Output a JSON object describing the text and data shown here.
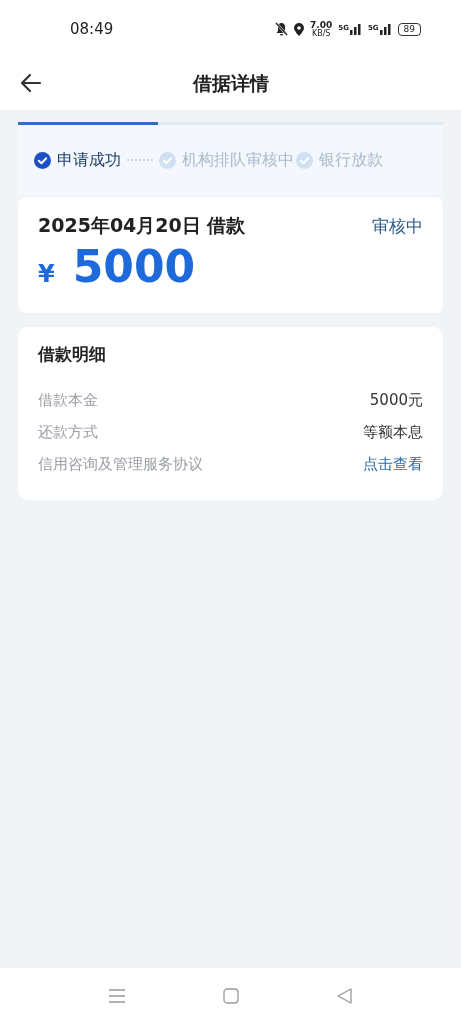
{
  "status_bar": {
    "time": "08:49",
    "speed": "7.00",
    "speed_unit": "KB/S",
    "networks": [
      "5G",
      "5G"
    ],
    "battery": "89"
  },
  "header": {
    "title": "借据详情"
  },
  "progress": {
    "level": 0.33,
    "steps": [
      {
        "label": "申请成功",
        "done": true
      },
      {
        "label": "机构排队审核中",
        "done": false
      },
      {
        "label": "银行放款",
        "done": false
      }
    ]
  },
  "loan": {
    "date": "2025年04月20日 借款",
    "status": "审核中",
    "currency": "¥",
    "amount": "5000"
  },
  "details": {
    "title": "借款明细",
    "rows": [
      {
        "label": "借款本金",
        "value": "5000元",
        "kind": "text"
      },
      {
        "label": "还款方式",
        "value": "等额本息",
        "kind": "text"
      },
      {
        "label": "信用咨询及管理服务协议",
        "value": "点击查看",
        "kind": "link"
      }
    ]
  }
}
